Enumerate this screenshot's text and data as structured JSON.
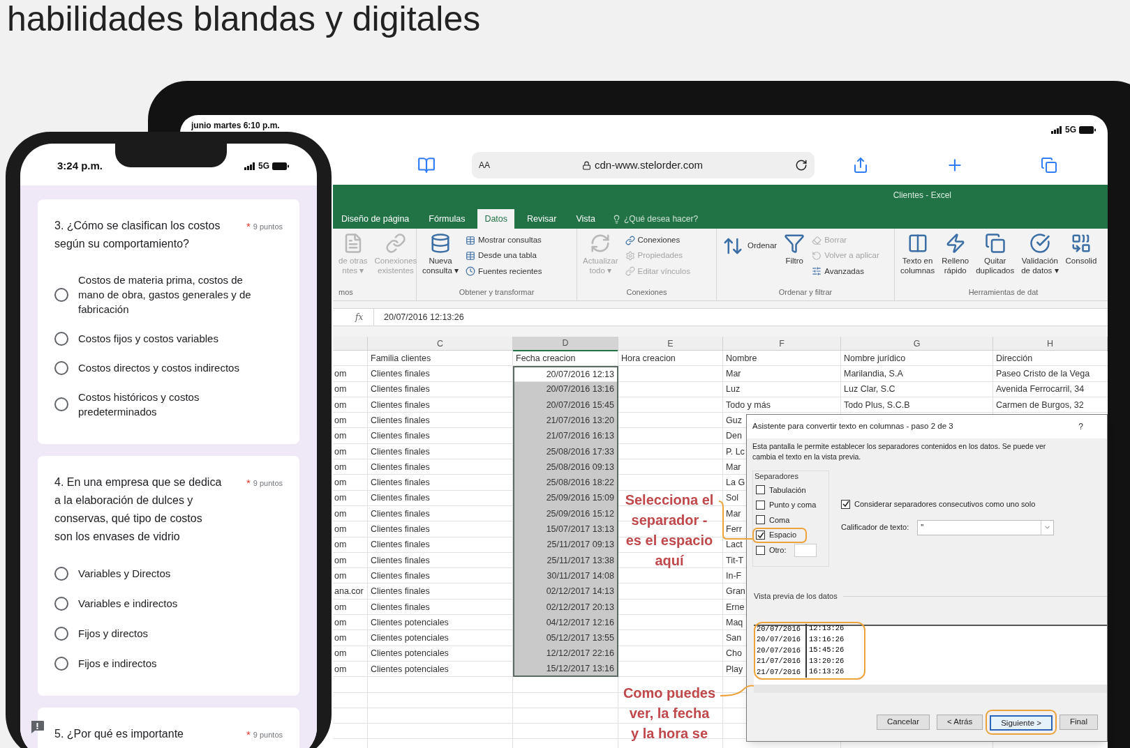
{
  "heading": "habilidades blandas y digitales",
  "tablet": {
    "datetime": "junio martes 6:10 p.m.",
    "network": "5G",
    "browser": {
      "text_size": "AA",
      "url": "cdn-www.stelorder.com"
    },
    "excel": {
      "title": "Clientes - Excel",
      "tabs": [
        {
          "label": "Diseño de página",
          "selected": false
        },
        {
          "label": "Fórmulas",
          "selected": false
        },
        {
          "label": "Datos",
          "selected": true
        },
        {
          "label": "Revisar",
          "selected": false
        },
        {
          "label": "Vista",
          "selected": false
        }
      ],
      "tell_me": "¿Qué desea hacer?",
      "ribbon_groups": [
        {
          "label": "mos",
          "items": [
            {
              "kind": "large",
              "label": "de otras\nntes ▾",
              "disabled": true
            },
            {
              "kind": "large",
              "label": "Conexiones\nexistentes",
              "disabled": true
            }
          ]
        },
        {
          "label": "Obtener y transformar",
          "items": [
            {
              "kind": "large",
              "label": "Nueva\nconsulta ▾",
              "disabled": false
            },
            {
              "kind": "stack",
              "items": [
                {
                  "label": "Mostrar consultas",
                  "disabled": false
                },
                {
                  "label": "Desde una tabla",
                  "disabled": false
                },
                {
                  "label": "Fuentes recientes",
                  "disabled": false
                }
              ]
            }
          ]
        },
        {
          "label": "Conexiones",
          "items": [
            {
              "kind": "large",
              "label": "Actualizar\ntodo ▾",
              "disabled": true
            },
            {
              "kind": "stack",
              "items": [
                {
                  "label": "Conexiones",
                  "disabled": false
                },
                {
                  "label": "Propiedades",
                  "disabled": true
                },
                {
                  "label": "Editar vínculos",
                  "disabled": true
                }
              ]
            }
          ]
        },
        {
          "label": "Ordenar y filtrar",
          "items": [
            {
              "kind": "sort",
              "label": "Ordenar",
              "disabled": false
            },
            {
              "kind": "large",
              "label": "Filtro",
              "disabled": false
            },
            {
              "kind": "stack",
              "items": [
                {
                  "label": "Borrar",
                  "disabled": true
                },
                {
                  "label": "Volver a aplicar",
                  "disabled": true
                },
                {
                  "label": "Avanzadas",
                  "disabled": false
                }
              ]
            }
          ]
        },
        {
          "label": "Herramientas de dat",
          "items": [
            {
              "kind": "large",
              "label": "Texto en\ncolumnas",
              "disabled": false
            },
            {
              "kind": "large",
              "label": "Relleno\nrápido",
              "disabled": false
            },
            {
              "kind": "large",
              "label": "Quitar\nduplicados",
              "disabled": false
            },
            {
              "kind": "large",
              "label": "Validación\nde datos ▾",
              "disabled": false
            },
            {
              "kind": "large",
              "label": "Consolid",
              "disabled": false
            }
          ]
        }
      ],
      "function_label": "fx",
      "formula": "20/07/2016 12:13:26",
      "columns": [
        {
          "label": "C",
          "selected": false
        },
        {
          "label": "D",
          "selected": true
        },
        {
          "label": "E",
          "selected": false
        },
        {
          "label": "F",
          "selected": false
        },
        {
          "label": "G",
          "selected": false
        },
        {
          "label": "H",
          "selected": false
        }
      ],
      "rows": [
        {
          "selected": false,
          "active": false,
          "c": "Familia clientes",
          "d": "Fecha creacion",
          "e": "Hora creacion",
          "f": "Nombre",
          "g": "Nombre jurídico",
          "h": "Dirección"
        },
        {
          "selected": true,
          "active": true,
          "b": "om",
          "c": "Clientes finales",
          "d": "20/07/2016 12:13",
          "f": "Mar",
          "g": "Marilandia, S.A",
          "h": "Paseo Cristo de la Vega"
        },
        {
          "selected": true,
          "active": false,
          "b": "om",
          "c": "Clientes finales",
          "d": "20/07/2016 13:16",
          "f": "Luz",
          "g": "Luz Clar, S.C",
          "h": "Avenida Ferrocarril, 34"
        },
        {
          "selected": true,
          "active": false,
          "b": "om",
          "c": "Clientes finales",
          "d": "20/07/2016 15:45",
          "f": "Todo y más",
          "g": "Todo Plus, S.C.B",
          "h": "Carmen de Burgos, 32"
        },
        {
          "selected": true,
          "active": false,
          "b": "om",
          "c": "Clientes finales",
          "d": "21/07/2016 13:20",
          "f": "Guz"
        },
        {
          "selected": true,
          "active": false,
          "b": "om",
          "c": "Clientes finales",
          "d": "21/07/2016 16:13",
          "f": "Den"
        },
        {
          "selected": true,
          "active": false,
          "b": "om",
          "c": "Clientes finales",
          "d": "25/08/2016 17:33",
          "f": "P. Lc"
        },
        {
          "selected": true,
          "active": false,
          "b": "om",
          "c": "Clientes finales",
          "d": "25/08/2016 09:13",
          "f": "Mar"
        },
        {
          "selected": true,
          "active": false,
          "b": "om",
          "c": "Clientes finales",
          "d": "25/08/2016 18:22",
          "f": "La G"
        },
        {
          "selected": true,
          "active": false,
          "b": "om",
          "c": "Clientes finales",
          "d": "25/09/2016 15:09",
          "f": "Sol"
        },
        {
          "selected": true,
          "active": false,
          "b": "om",
          "c": "Clientes finales",
          "d": "25/09/2016 15:12",
          "f": "Mar"
        },
        {
          "selected": true,
          "active": false,
          "b": "om",
          "c": "Clientes finales",
          "d": "15/07/2017 13:13",
          "f": "Ferr"
        },
        {
          "selected": true,
          "active": false,
          "b": "om",
          "c": "Clientes finales",
          "d": "25/11/2017 09:13",
          "f": "Lact"
        },
        {
          "selected": true,
          "active": false,
          "b": "om",
          "c": "Clientes finales",
          "d": "25/11/2017 13:38",
          "f": "Tit-T"
        },
        {
          "selected": true,
          "active": false,
          "b": "om",
          "c": "Clientes finales",
          "d": "30/11/2017 14:08",
          "f": "In-F"
        },
        {
          "selected": true,
          "active": false,
          "b": "ana.cor",
          "c": "Clientes finales",
          "d": "02/12/2017 14:13",
          "f": "Gran"
        },
        {
          "selected": true,
          "active": false,
          "b": "om",
          "c": "Clientes finales",
          "d": "02/12/2017 20:13",
          "f": "Erne"
        },
        {
          "selected": true,
          "active": false,
          "b": "om",
          "c": "Clientes potenciales",
          "d": "04/12/2017 12:16",
          "f": "Maq"
        },
        {
          "selected": true,
          "active": false,
          "b": "om",
          "c": "Clientes potenciales",
          "d": "05/12/2017 13:55",
          "f": "San"
        },
        {
          "selected": true,
          "active": false,
          "b": "om",
          "c": "Clientes potenciales",
          "d": "12/12/2017 22:16",
          "f": "Cho"
        },
        {
          "selected": true,
          "active": false,
          "b": "om",
          "c": "Clientes potenciales",
          "d": "15/12/2017 13:16",
          "f": "Play"
        }
      ]
    },
    "dialog": {
      "title": "Asistente para convertir texto en columnas - paso 2 de 3",
      "help": "?",
      "description_lines": [
        "Esta pantalla le permite establecer los separadores contenidos en los datos. Se puede ver",
        "cambia el texto en la vista previa."
      ],
      "separators_label": "Separadores",
      "separators": [
        {
          "kind": "checkbox",
          "label": "Tabulación",
          "checked": false,
          "highlighted": false
        },
        {
          "kind": "checkbox",
          "label": "Punto y coma",
          "checked": false,
          "highlighted": false
        },
        {
          "kind": "checkbox",
          "label": "Coma",
          "checked": false,
          "highlighted": false
        },
        {
          "kind": "checkbox",
          "label": "Espacio",
          "checked": true,
          "highlighted": true
        },
        {
          "kind": "checkbox_with_field",
          "label": "Otro:",
          "checked": false,
          "highlighted": false
        }
      ],
      "consecutive": {
        "label": "Considerar separadores consecutivos como uno solo",
        "checked": true
      },
      "qualifier": {
        "label": "Calificador de texto:",
        "value": "\""
      },
      "preview_label": "Vista previa de los datos",
      "preview_highlighted": true,
      "preview_rows": [
        [
          "20/07/2016",
          "12:13:26"
        ],
        [
          "20/07/2016",
          "13:16:26"
        ],
        [
          "20/07/2016",
          "15:45:26"
        ],
        [
          "21/07/2016",
          "13:20:26"
        ],
        [
          "21/07/2016",
          "16:13:26"
        ]
      ],
      "buttons": [
        {
          "label": "Cancelar",
          "default": false,
          "highlighted": false
        },
        {
          "label": "< Atrás",
          "default": false,
          "highlighted": false
        },
        {
          "label": "Siguiente >",
          "default": true,
          "highlighted": true
        },
        {
          "label": "Final",
          "default": false,
          "highlighted": false
        }
      ]
    }
  },
  "annotations": [
    {
      "text": "Selecciona el\nseparador -\nes el espacio\naquí"
    },
    {
      "text": "Como puedes\nver, la fecha\ny la hora se"
    }
  ],
  "phone": {
    "time": "3:24 p.m.",
    "network": "5G",
    "questions": [
      {
        "text": "3. ¿Cómo se clasifican los costos\nsegún su comportamiento?",
        "required_mark": "*",
        "points": "9 puntos",
        "options": [
          {
            "label": "Costos de materia prima, costos de mano de obra, gastos generales y de fabricación",
            "selected": false
          },
          {
            "label": "Costos fijos y costos variables",
            "selected": false
          },
          {
            "label": "Costos directos y costos indirectos",
            "selected": false
          },
          {
            "label": "Costos históricos y costos predeterminados",
            "selected": false
          }
        ]
      },
      {
        "text": "4. En una empresa que se dedica\na la elaboración de dulces y\nconservas, qué tipo de costos\nson los envases de vidrio",
        "required_mark": "*",
        "points": "9 puntos",
        "options": [
          {
            "label": "Variables y Directos",
            "selected": false
          },
          {
            "label": "Variables e indirectos",
            "selected": false
          },
          {
            "label": "Fijos y directos",
            "selected": false
          },
          {
            "label": "Fijos e indirectos",
            "selected": false
          }
        ]
      },
      {
        "text": "5. ¿Por qué es importante",
        "required_mark": "*",
        "points": "9 puntos"
      }
    ]
  }
}
